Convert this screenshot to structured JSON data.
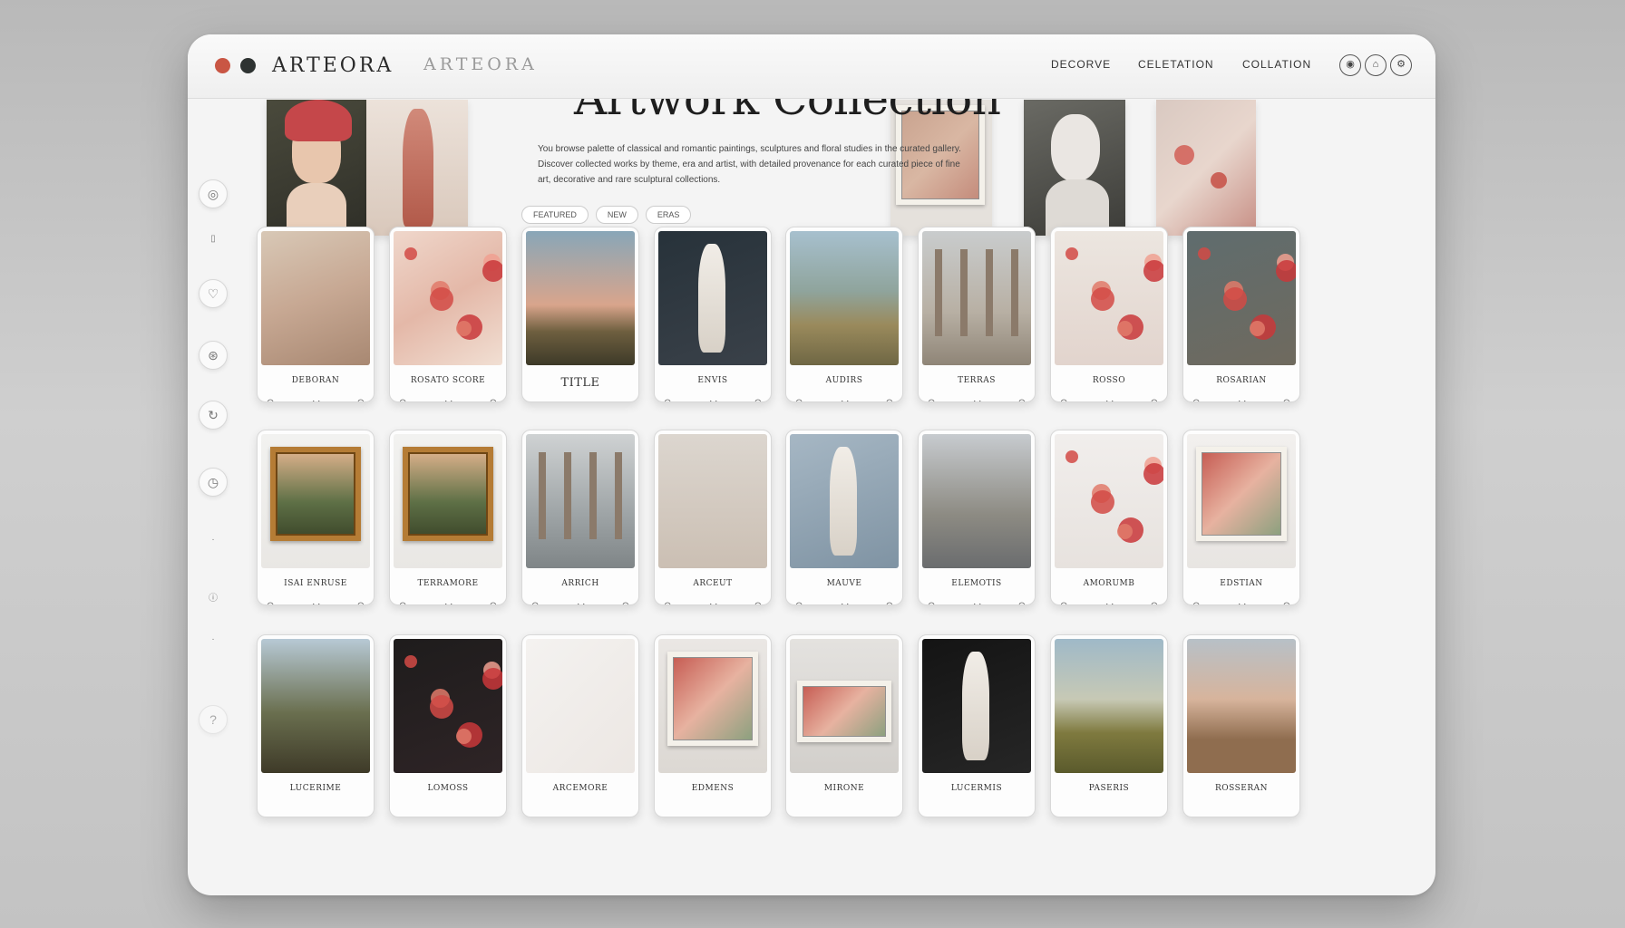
{
  "brand": {
    "logo": "ARTEORA",
    "logo_ghost": "ARTEORA"
  },
  "nav": [
    "DECORVE",
    "CELETATION",
    "COLLATION"
  ],
  "top_icons": [
    "user-icon",
    "cart-icon",
    "settings-icon"
  ],
  "sidebar_icons": [
    "home-icon",
    "book-icon",
    "heart-icon",
    "gallery-icon",
    "refresh-icon",
    "clock-icon",
    "dot-icon",
    "info-icon",
    "dot-icon",
    "help-icon"
  ],
  "hero": {
    "title": "Artwork Collection",
    "description": "You browse palette of classical and romantic paintings, sculptures and floral studies in the curated gallery. Discover collected works by theme, era and artist, with detailed provenance for each curated piece of fine art, decorative and rare sculptural collections.",
    "chips": [
      "FEATURED",
      "NEW",
      "ERAS"
    ]
  },
  "cards": [
    {
      "title": "DEBORAN",
      "actions": [
        "⊙",
        "◔◔",
        "⊙"
      ]
    },
    {
      "title": "ROSATO SCORE",
      "actions": [
        "⊙",
        "◔◔",
        "⊙"
      ]
    },
    {
      "title": "TITLE",
      "actions": [
        "⊙",
        "◔◔",
        "⊙"
      ]
    },
    {
      "title": "ENVIS",
      "actions": [
        "⊙",
        "◔◔",
        "⊙"
      ]
    },
    {
      "title": "AUDIRS",
      "actions": [
        "⊙",
        "◔◔",
        "⊙"
      ]
    },
    {
      "title": "TERRAS",
      "actions": [
        "⊙",
        "◔◔",
        "⊙"
      ]
    },
    {
      "title": "ROSSO",
      "actions": [
        "⊙",
        "◔◔",
        "⊙"
      ]
    },
    {
      "title": "ROSARIAN",
      "actions": [
        "⊙",
        "◔◔",
        "⊙"
      ]
    },
    {
      "title": "ISAI ENRUSE",
      "actions": [
        "⊙",
        "◔◔",
        "⊙"
      ]
    },
    {
      "title": "TERRAMORE",
      "actions": [
        "⊙",
        "◔◔",
        "⊙"
      ]
    },
    {
      "title": "ARRICH",
      "actions": [
        "⊙",
        "◔◔",
        "⊙"
      ]
    },
    {
      "title": "ARCEUT",
      "actions": [
        "⊙",
        "◔◔",
        "⊙"
      ]
    },
    {
      "title": "MAUVE",
      "actions": [
        "⊙",
        "◔◔",
        "⊙"
      ]
    },
    {
      "title": "ELEMOTIS",
      "actions": [
        "⊙",
        "◔◔",
        "⊙"
      ]
    },
    {
      "title": "AMORUMB",
      "actions": [
        "⊙",
        "◔◔",
        "⊙"
      ]
    },
    {
      "title": "EDSTIAN",
      "actions": [
        "⊙",
        "◔◔",
        "⊙"
      ]
    },
    {
      "title": "LUCERIME",
      "actions": [
        "⊙",
        "◔◔",
        "⊙"
      ]
    },
    {
      "title": "LOMOSS",
      "actions": [
        "⊙",
        "◔◔",
        "⊙"
      ]
    },
    {
      "title": "ARCEMORE",
      "actions": [
        "⊙",
        "◔◔",
        "⊙"
      ]
    },
    {
      "title": "EDMENS",
      "actions": [
        "⊙",
        "◔◔",
        "⊙"
      ]
    },
    {
      "title": "MIRONE",
      "actions": [
        "⊙",
        "◔◔",
        "⊙"
      ]
    },
    {
      "title": "LUCERMIS",
      "actions": [
        "⊙",
        "◔◔",
        "⊙"
      ]
    },
    {
      "title": "PASERIS",
      "actions": [
        "⊙",
        "◔◔",
        "⊙"
      ]
    },
    {
      "title": "ROSSERAN",
      "actions": [
        "⊙",
        "◔◔",
        "⊙"
      ]
    }
  ],
  "colors": {
    "accent": "#c95644",
    "dark": "#2e3332",
    "window": "#f4f4f4"
  }
}
